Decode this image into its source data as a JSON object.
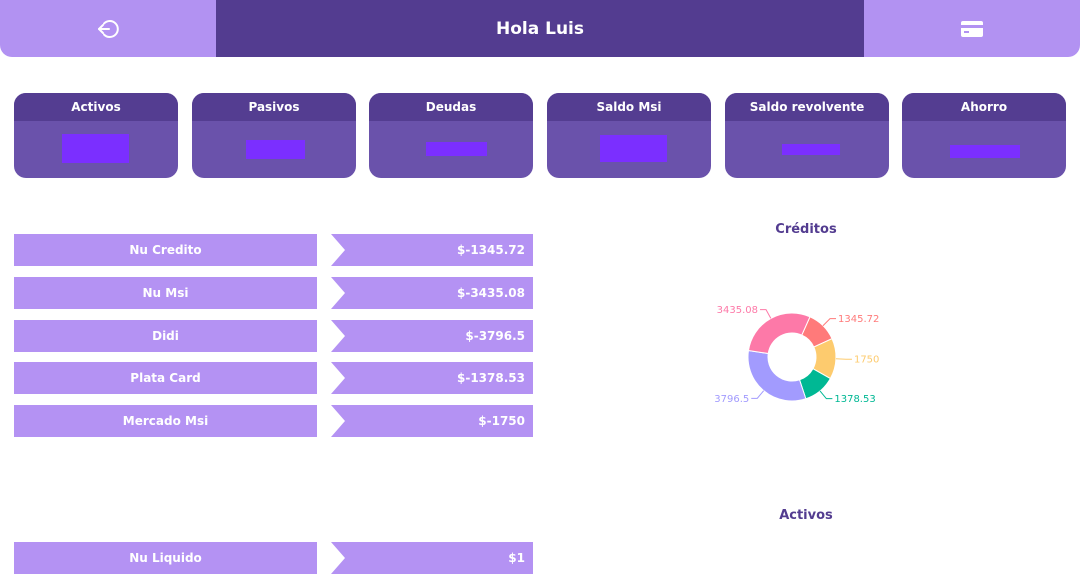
{
  "header": {
    "greeting": "Hola Luis",
    "logout_icon": "logout-icon",
    "card_icon": "credit-card-icon",
    "bar_color": "#533c90",
    "accent_color": "#b292f2"
  },
  "summary_cards": [
    {
      "title": "Activos"
    },
    {
      "title": "Pasivos"
    },
    {
      "title": "Deudas"
    },
    {
      "title": "Saldo Msi"
    },
    {
      "title": "Saldo revolvente"
    },
    {
      "title": "Ahorro"
    }
  ],
  "credits": [
    {
      "name": "Nu Credito",
      "amount": "$-1345.72"
    },
    {
      "name": "Nu Msi",
      "amount": "$-3435.08"
    },
    {
      "name": "Didi",
      "amount": "$-3796.5"
    },
    {
      "name": "Plata Card",
      "amount": "$-1378.53"
    },
    {
      "name": "Mercado Msi",
      "amount": "$-1750"
    }
  ],
  "assets": [
    {
      "name": "Nu Liquido",
      "amount": "$1"
    }
  ],
  "chart_data": [
    {
      "type": "pie",
      "title": "Créditos",
      "donut": true,
      "slices": [
        {
          "label": "1345.72",
          "value": 1345.72,
          "color": "#ff7a7a"
        },
        {
          "label": "1750",
          "value": 1750,
          "color": "#fdcb6e"
        },
        {
          "label": "1378.53",
          "value": 1378.53,
          "color": "#00b894"
        },
        {
          "label": "3796.5",
          "value": 3796.5,
          "color": "#a29bfe"
        },
        {
          "label": "3435.08",
          "value": 3435.08,
          "color": "#fd79a8"
        }
      ]
    },
    {
      "type": "pie",
      "title": "Activos",
      "slices": []
    }
  ]
}
